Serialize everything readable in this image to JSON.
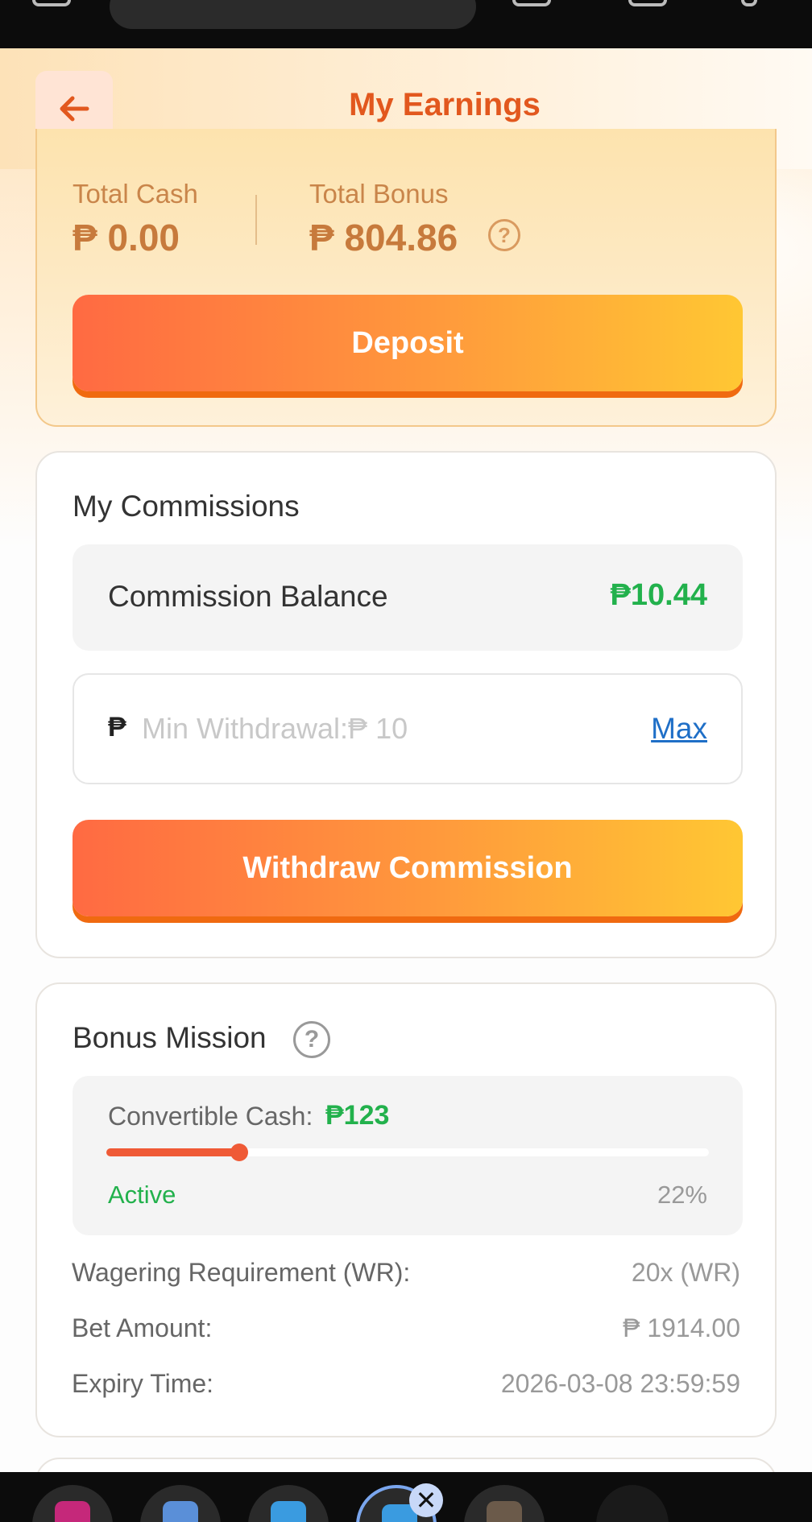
{
  "header": {
    "title": "My Earnings"
  },
  "balance": {
    "total_cash_label": "Total Cash",
    "total_cash_value": "₱ 0.00",
    "total_bonus_label": "Total Bonus",
    "total_bonus_value": "₱ 804.86",
    "help_glyph": "?",
    "deposit_label": "Deposit"
  },
  "commissions": {
    "title": "My Commissions",
    "balance_label": "Commission Balance",
    "balance_value": "₱10.44",
    "currency_symbol": "₱",
    "amount_placeholder": "Min Withdrawal:₱ 10",
    "max_label": "Max",
    "withdraw_label": "Withdraw Commission"
  },
  "bonus_mission": {
    "title": "Bonus Mission",
    "help_glyph": "?",
    "convertible_label": "Convertible Cash:",
    "convertible_value": "₱123",
    "progress_percent": 22,
    "status": "Active",
    "progress_text": "22%",
    "rows": [
      {
        "label": "Wagering Requirement (WR):",
        "value": "20x (WR)"
      },
      {
        "label": "Bet Amount:",
        "value": "₱ 1914.00"
      },
      {
        "label": "Expiry Time:",
        "value": "2026-03-08 23:59:59"
      }
    ]
  },
  "bottom_nav": {
    "close_glyph": "✕"
  },
  "colors": {
    "accent": "#e2581e",
    "positive": "#22b14c",
    "link": "#1f6fc7",
    "progress": "#ef5a36"
  }
}
